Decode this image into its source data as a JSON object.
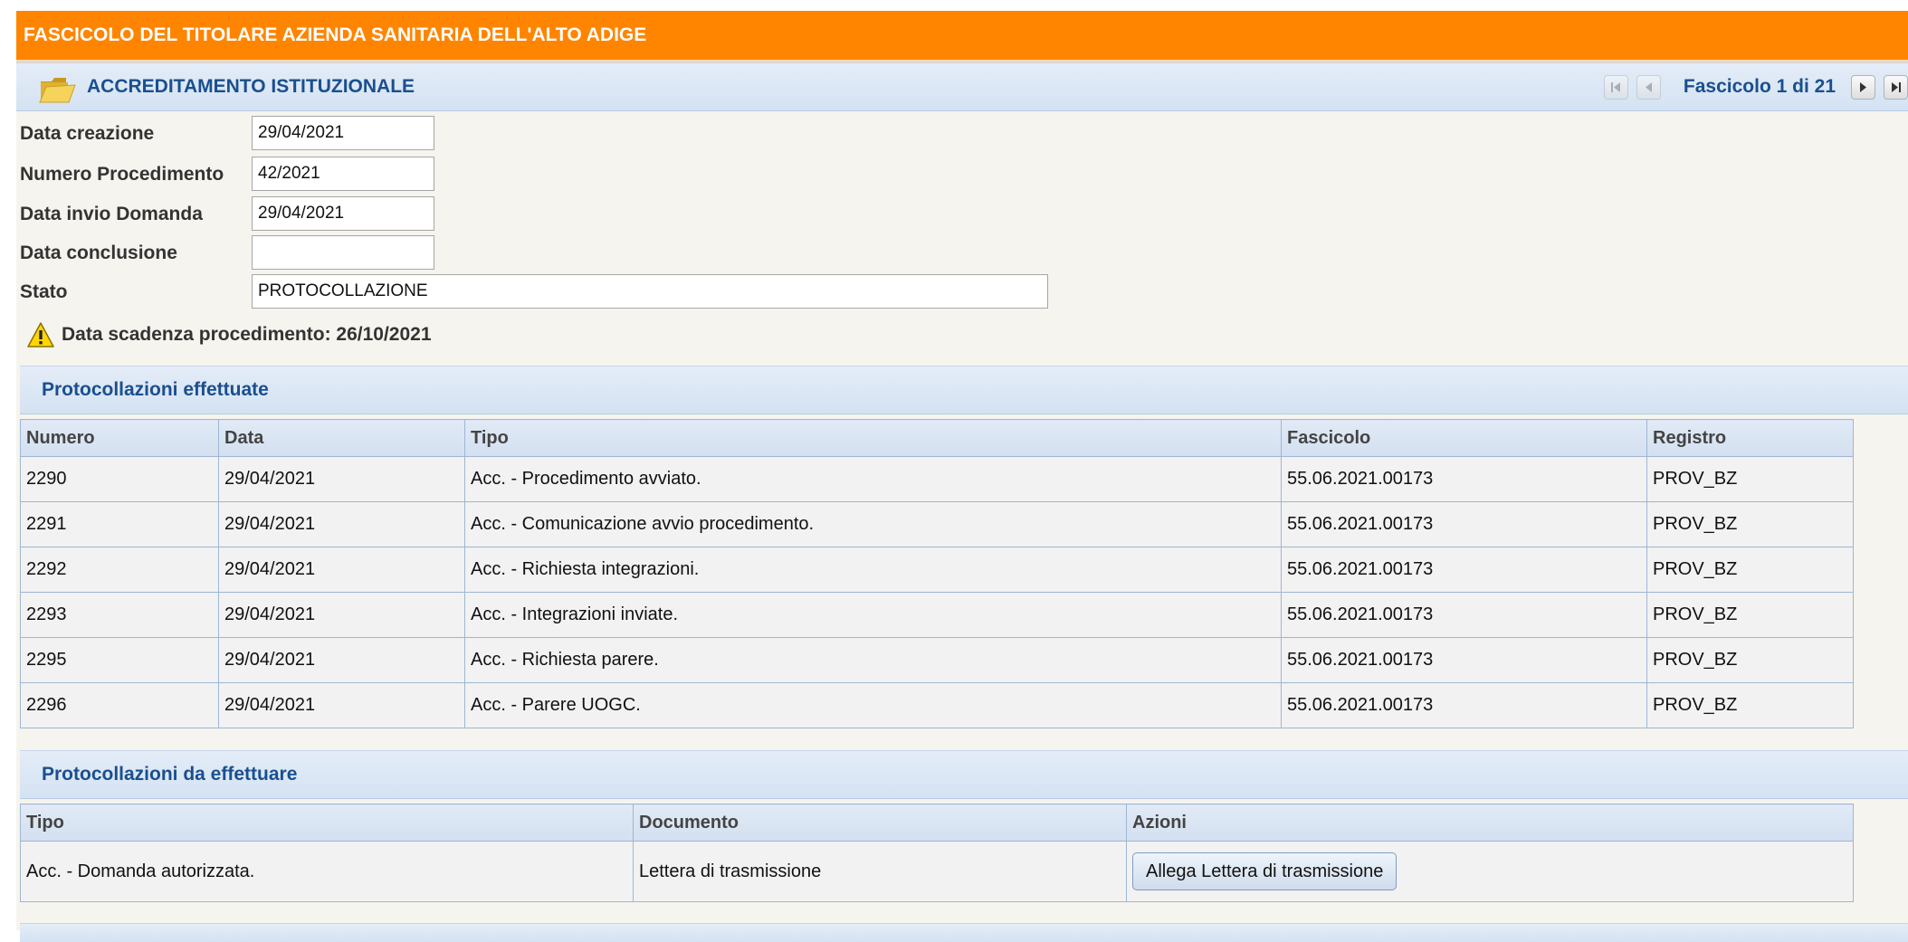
{
  "header": {
    "title": "FASCICOLO DEL TITOLARE AZIENDA SANITARIA DELL'ALTO ADIGE"
  },
  "section": {
    "title": "ACCREDITAMENTO ISTITUZIONALE",
    "folder_icon": "folder-icon",
    "pager": {
      "text": "Fascicolo 1 di 21"
    }
  },
  "form": {
    "data_creazione": {
      "label": "Data creazione",
      "value": "29/04/2021"
    },
    "numero_procedimento": {
      "label": "Numero Procedimento",
      "value": "42/2021"
    },
    "data_invio": {
      "label": "Data invio Domanda",
      "value": "29/04/2021"
    },
    "data_conclusione": {
      "label": "Data conclusione",
      "value": ""
    },
    "stato": {
      "label": "Stato",
      "value": "PROTOCOLLAZIONE"
    }
  },
  "warning": {
    "icon": "warning-icon",
    "text": "Data scadenza procedimento: 26/10/2021"
  },
  "effettuate": {
    "title": "Protocollazioni effettuate",
    "columns": [
      "Numero",
      "Data",
      "Tipo",
      "Fascicolo",
      "Registro"
    ],
    "rows": [
      [
        "2290",
        "29/04/2021",
        "Acc. - Procedimento avviato.",
        "55.06.2021.00173",
        "PROV_BZ"
      ],
      [
        "2291",
        "29/04/2021",
        "Acc. - Comunicazione avvio procedimento.",
        "55.06.2021.00173",
        "PROV_BZ"
      ],
      [
        "2292",
        "29/04/2021",
        "Acc. - Richiesta integrazioni.",
        "55.06.2021.00173",
        "PROV_BZ"
      ],
      [
        "2293",
        "29/04/2021",
        "Acc. - Integrazioni inviate.",
        "55.06.2021.00173",
        "PROV_BZ"
      ],
      [
        "2295",
        "29/04/2021",
        "Acc. - Richiesta parere.",
        "55.06.2021.00173",
        "PROV_BZ"
      ],
      [
        "2296",
        "29/04/2021",
        "Acc. - Parere UOGC.",
        "55.06.2021.00173",
        "PROV_BZ"
      ]
    ]
  },
  "da_effettuare": {
    "title": "Protocollazioni da effettuare",
    "columns": [
      "Tipo",
      "Documento",
      "Azioni"
    ],
    "rows": [
      {
        "tipo": "Acc. - Domanda autorizzata.",
        "documento": "Lettera di trasmissione",
        "azione": "Allega Lettera di trasmissione"
      }
    ]
  },
  "colors": {
    "header": "#ff8500",
    "section_title": "#1a4f8f",
    "table_border": "#9fb6d3"
  }
}
